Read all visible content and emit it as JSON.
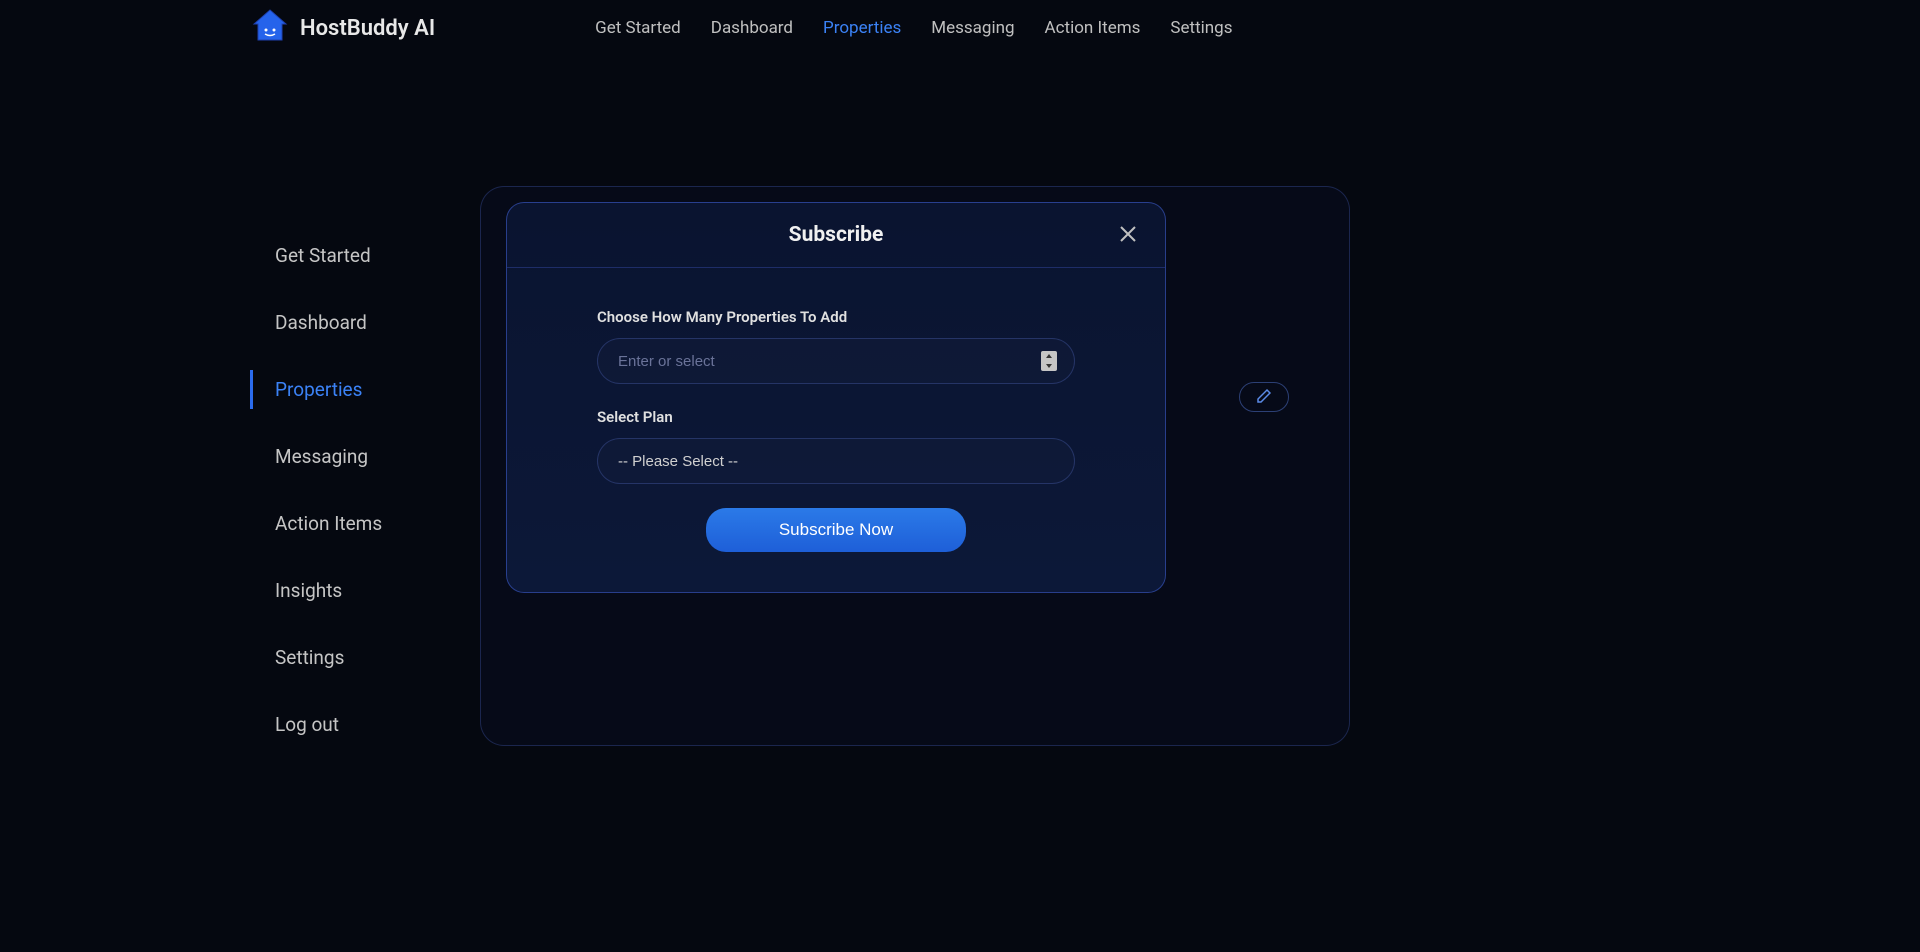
{
  "brand": {
    "name": "HostBuddy AI"
  },
  "topNav": {
    "items": [
      {
        "label": "Get Started",
        "active": false
      },
      {
        "label": "Dashboard",
        "active": false
      },
      {
        "label": "Properties",
        "active": true
      },
      {
        "label": "Messaging",
        "active": false
      },
      {
        "label": "Action Items",
        "active": false
      },
      {
        "label": "Settings",
        "active": false
      }
    ]
  },
  "sidebar": {
    "items": [
      {
        "label": "Get Started",
        "active": false
      },
      {
        "label": "Dashboard",
        "active": false
      },
      {
        "label": "Properties",
        "active": true
      },
      {
        "label": "Messaging",
        "active": false
      },
      {
        "label": "Action Items",
        "active": false
      },
      {
        "label": "Insights",
        "active": false
      },
      {
        "label": "Settings",
        "active": false
      },
      {
        "label": "Log out",
        "active": false
      }
    ]
  },
  "modal": {
    "title": "Subscribe",
    "propertiesLabel": "Choose How Many Properties To Add",
    "propertiesPlaceholder": "Enter or select",
    "propertiesValue": "",
    "planLabel": "Select Plan",
    "planSelectedText": "-- Please Select --",
    "submitLabel": "Subscribe Now"
  },
  "colors": {
    "accent": "#3b82f6",
    "background": "#050810",
    "panelBg": "#060a18"
  }
}
